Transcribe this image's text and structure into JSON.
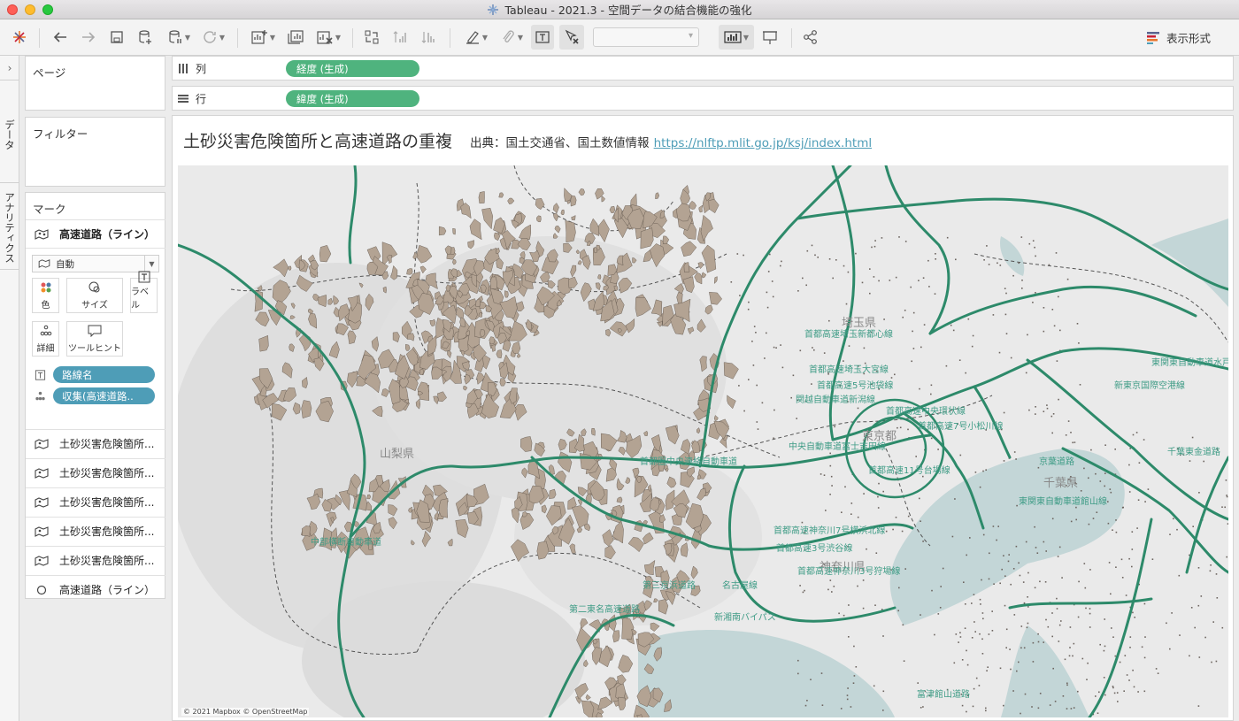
{
  "window": {
    "title": "Tableau - 2021.3 - 空間データの結合機能の強化"
  },
  "toolbar": {
    "show_me_label": "表示形式",
    "icons": [
      "tableau-logo-icon",
      "back-icon",
      "forward-icon",
      "save-icon",
      "new-datasource-icon",
      "pause-update-icon",
      "refresh-icon",
      "new-worksheet-icon",
      "duplicate-sheet-icon",
      "clear-sheet-icon",
      "swap-icon",
      "sort-ascending-icon",
      "sort-descending-icon",
      "highlight-icon",
      "group-icon",
      "show-labels-icon",
      "fix-axes-icon",
      "fit-dropdown",
      "show-me-icon",
      "presentation-icon",
      "share-icon"
    ]
  },
  "side_tabs": {
    "data": "データ",
    "analytics": "アナリティクス"
  },
  "pages_panel": {
    "title": "ページ"
  },
  "filters_panel": {
    "title": "フィルター"
  },
  "marks_panel": {
    "title": "マーク",
    "active_layer": "高速道路（ライン）",
    "mark_type": "自動",
    "buttons": {
      "color": "色",
      "size": "サイズ",
      "label": "ラベル",
      "detail": "詳細",
      "tooltip": "ツールヒント"
    },
    "pills": [
      {
        "label": "路線名",
        "icon": "label-icon"
      },
      {
        "label": "収集(高速道路..",
        "icon": "detail-icon"
      }
    ],
    "layers": [
      {
        "label": "土砂災害危険箇所...",
        "icon": "map-layer-icon"
      },
      {
        "label": "土砂災害危険箇所...",
        "icon": "map-layer-icon"
      },
      {
        "label": "土砂災害危険箇所...",
        "icon": "map-layer-icon"
      },
      {
        "label": "土砂災害危険箇所...",
        "icon": "map-layer-icon"
      },
      {
        "label": "土砂災害危険箇所...",
        "icon": "map-layer-icon"
      },
      {
        "label": "高速道路（ライン）",
        "icon": "circle-icon"
      }
    ]
  },
  "shelves": {
    "columns": {
      "label": "列",
      "pill": "経度 (生成)"
    },
    "rows": {
      "label": "行",
      "pill": "緯度 (生成)"
    }
  },
  "viz": {
    "title": "土砂災害危険箇所と高速道路の重複",
    "source": "出典：国土交通省、国土数値情報",
    "link": "https://nlftp.mlit.go.jp/ksj/index.html",
    "attribution": "© 2021 Mapbox © OpenStreetMap"
  },
  "map": {
    "colors": {
      "land": "#eaeaea",
      "water": "#c3d6d7",
      "landslide": "#b3a393",
      "highway": "#2d8a6a"
    },
    "prefecture_labels": [
      "埼玉県",
      "東京都",
      "山梨県",
      "千葉県",
      "神奈川県"
    ],
    "road_labels": [
      "首都高速埼玉新都心線",
      "首都高速埼玉大宮線",
      "首都高速5号池袋線",
      "関越自動車道新潟線",
      "首都高速中央環状線",
      "首都高速7号小松川線",
      "中央自動車道富士吉田線",
      "首都高速11号台場線",
      "首都圏中央連絡自動車道",
      "東関東自動車道水戸線",
      "新東京国際空港線",
      "千葉東金道路",
      "京葉道路",
      "東関東自動車道館山線",
      "中部横断自動車道",
      "第三京浜道路",
      "第二東名高速道路",
      "首都高速神奈川7号横浜北線",
      "首都高速神奈川3号狩場線",
      "首都高速3号渋谷線",
      "新湘南バイパス",
      "名古屋線",
      "富津館山道路"
    ]
  }
}
